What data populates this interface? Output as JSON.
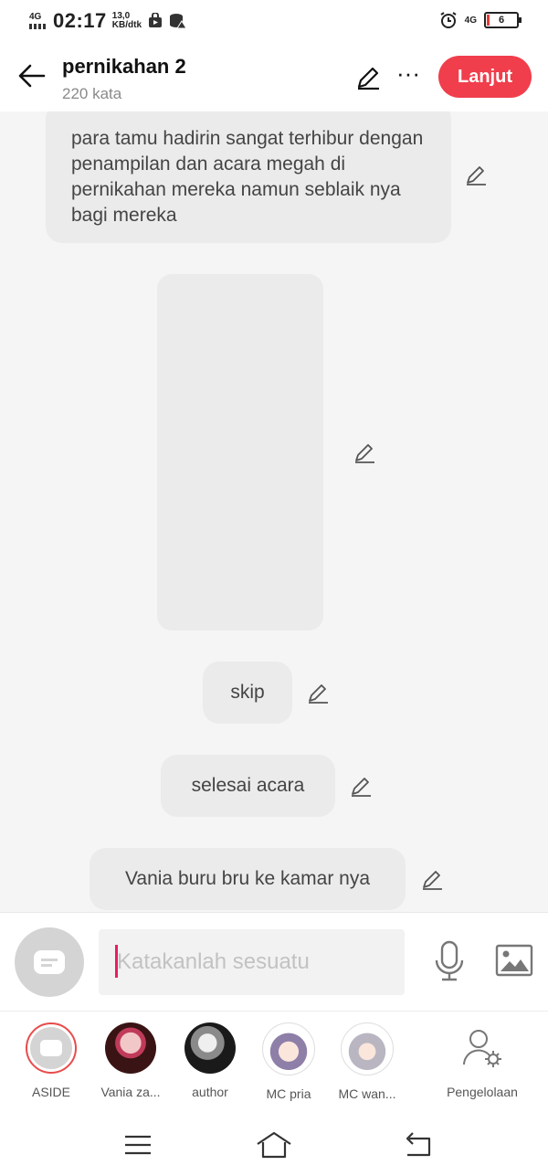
{
  "status_bar": {
    "network_left": "4G",
    "time": "02:17",
    "speed_value": "13,0",
    "speed_unit": "KB/dtk",
    "network_right": "4G",
    "battery": "6"
  },
  "header": {
    "title": "pernikahan 2",
    "word_count": "220 kata",
    "next_label": "Lanjut"
  },
  "messages": [
    "para tamu hadirin sangat terhibur dengan penampilan dan acara megah di pernikahan mereka namun seblaik nya bagi mereka",
    "skip",
    "selesai acara",
    "Vania buru bru ke kamar nya"
  ],
  "input": {
    "placeholder": "Katakanlah sesuatu"
  },
  "characters": [
    {
      "name": "ASIDE"
    },
    {
      "name": "Vania za..."
    },
    {
      "name": "author"
    },
    {
      "name": "MC pria"
    },
    {
      "name": "MC wan..."
    },
    {
      "name": "Pengelolaan"
    }
  ],
  "colors": {
    "accent": "#f03e4c",
    "bubble": "#ebebeb",
    "background": "#f5f5f5"
  },
  "icons": [
    "back-arrow-icon",
    "pencil-icon",
    "more-icon",
    "microphone-icon",
    "image-icon",
    "aside-icon",
    "person-gear-icon",
    "menu-icon",
    "home-icon",
    "return-icon"
  ]
}
